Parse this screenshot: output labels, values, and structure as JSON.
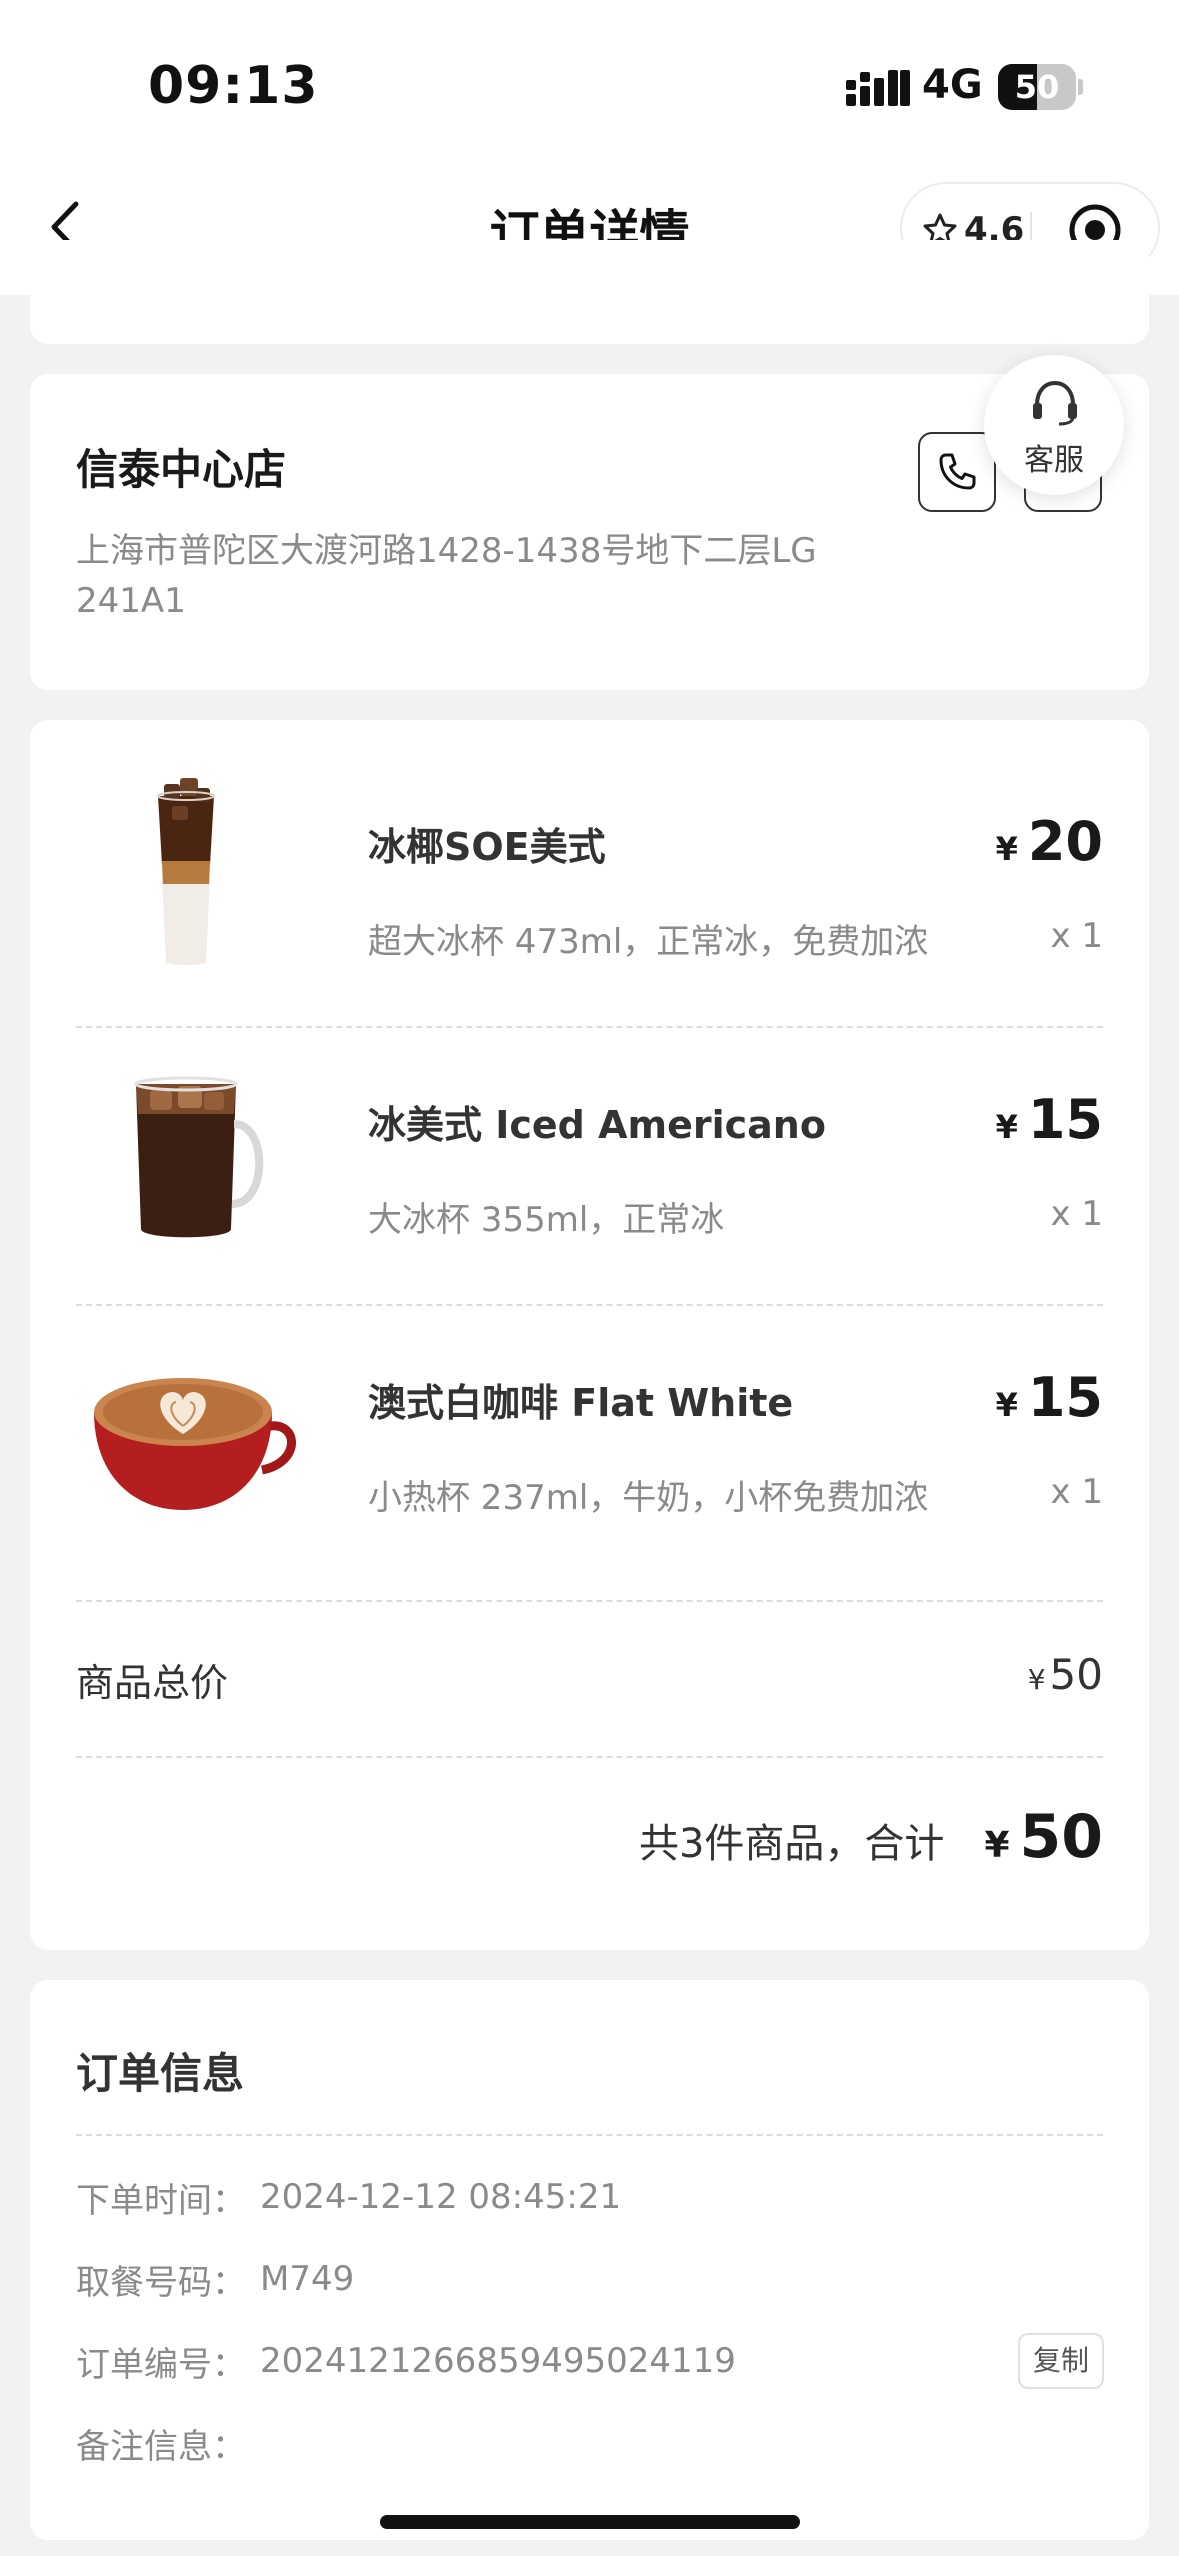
{
  "status_bar": {
    "time": "09:13",
    "network": "4G",
    "battery": "50",
    "battery_level": 0.5
  },
  "nav": {
    "title": "订单详情",
    "rating": "4.6"
  },
  "store": {
    "name": "信泰中心店",
    "address": "上海市普陀区大渡河路1428-1438号地下二层LG 241A1",
    "service_label": "客服"
  },
  "items": [
    {
      "name": "冰椰SOE美式",
      "spec": "超大冰杯 473ml，正常冰，免费加浓",
      "currency": "¥",
      "price": "20",
      "qty": "x 1",
      "image": "iced-coconut-coffee-image"
    },
    {
      "name": "冰美式 Iced Americano",
      "spec": "大冰杯 355ml，正常冰",
      "currency": "¥",
      "price": "15",
      "qty": "x 1",
      "image": "iced-americano-image"
    },
    {
      "name": "澳式白咖啡 Flat White",
      "spec": "小热杯 237ml，牛奶，小杯免费加浓",
      "currency": "¥",
      "price": "15",
      "qty": "x 1",
      "image": "flat-white-image"
    }
  ],
  "summary": {
    "subtotal_label": "商品总价",
    "currency": "¥",
    "subtotal": "50",
    "total_label": "共3件商品，合计",
    "total": "50"
  },
  "order_info": {
    "title": "订单信息",
    "rows": [
      {
        "label": "下单时间：",
        "value": "2024-12-12 08:45:21"
      },
      {
        "label": "取餐号码：",
        "value": "M749"
      },
      {
        "label": "订单编号：",
        "value": "20241212668594950241​19"
      },
      {
        "label": "备注信息：",
        "value": ""
      }
    ],
    "copy_label": "复制"
  },
  "colors": {
    "background": "#f2f2f4",
    "card": "#ffffff",
    "text_primary": "#1a1a1a",
    "text_secondary": "#8a8a8a"
  }
}
